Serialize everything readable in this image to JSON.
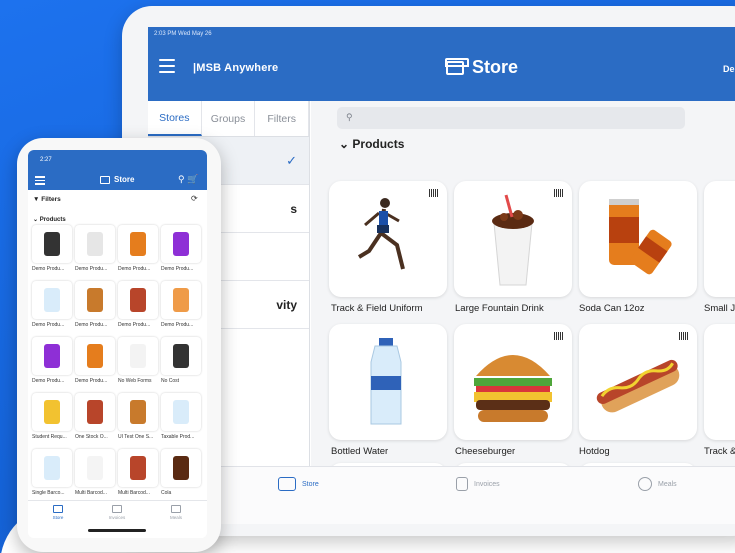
{
  "colors": {
    "brand_blue": "#2b6cc4",
    "background_blue": "#1c6ae5"
  },
  "tablet": {
    "status": "2:03 PM   Wed May 26",
    "app_name": "|MSB Anywhere",
    "title": "Store",
    "header_right": "De",
    "tabs": [
      "Stores",
      "Groups",
      "Filters"
    ],
    "side_rows": [
      "",
      "s",
      "",
      "vity",
      ""
    ],
    "search_icon": "search-icon",
    "products_header": "Products",
    "products": [
      "Track & Field Uniform",
      "Large Fountain Drink",
      "Soda Can 12oz",
      "Small Ju",
      "Bottled Water",
      "Cheeseburger",
      "Hotdog",
      "Track &"
    ],
    "nav": [
      "Store",
      "Invoices",
      "Meals"
    ]
  },
  "phone": {
    "status": "2:27",
    "title": "Store",
    "filters": "Filters",
    "products_header": "Products",
    "products": [
      "Demo Produ...",
      "Demo Produ...",
      "Demo Produ...",
      "Demo Produ...",
      "Demo Produ...",
      "Demo Produ...",
      "Demo Produ...",
      "Demo Produ...",
      "Demo Produ...",
      "Demo Produ...",
      "No Web Forms",
      "No Cost",
      "Student Requ...",
      "One Stock O...",
      "UI Test One S...",
      "Taxable Prod...",
      "Single Barco...",
      "Multi Barcod...",
      "Multi Barcod...",
      "Cola"
    ],
    "nav": [
      "Store",
      "Invoices",
      "Meals"
    ]
  }
}
